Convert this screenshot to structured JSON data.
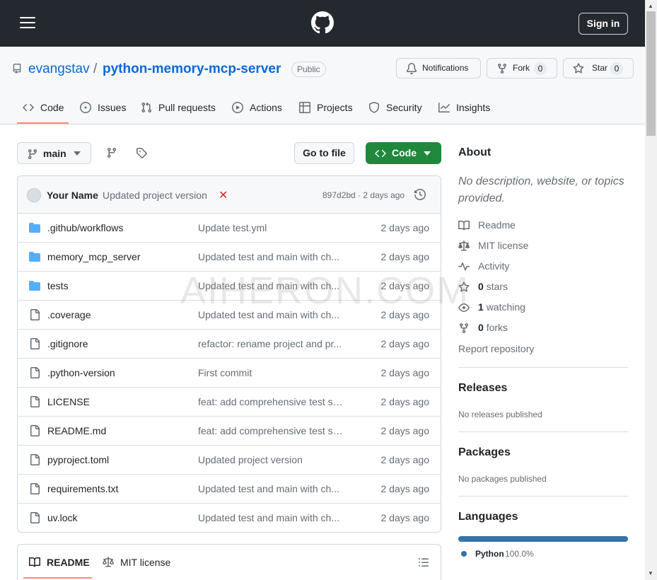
{
  "header": {
    "signin_label": "Sign in"
  },
  "repo": {
    "owner": "evangstav",
    "separator": "/",
    "name": "python-memory-mcp-server",
    "visibility": "Public",
    "notifications_label": "Notifications",
    "fork_label": "Fork",
    "fork_count": "0",
    "star_label": "Star",
    "star_count": "0"
  },
  "tabs": [
    {
      "label": "Code",
      "icon": "code-icon",
      "active": true
    },
    {
      "label": "Issues",
      "icon": "issue-icon"
    },
    {
      "label": "Pull requests",
      "icon": "pull-request-icon"
    },
    {
      "label": "Actions",
      "icon": "play-icon"
    },
    {
      "label": "Projects",
      "icon": "table-icon"
    },
    {
      "label": "Security",
      "icon": "shield-icon"
    },
    {
      "label": "Insights",
      "icon": "graph-icon"
    }
  ],
  "toolbar": {
    "branch": "main",
    "goto_file_label": "Go to file",
    "code_label": "Code"
  },
  "latest_commit": {
    "author": "Your Name",
    "message": "Updated project version",
    "status_mark": "✕",
    "meta": "897d2bd · 2 days ago"
  },
  "files": [
    {
      "name": ".github/workflows",
      "type": "folder",
      "message": "Update test.yml",
      "date": "2 days ago"
    },
    {
      "name": "memory_mcp_server",
      "type": "folder",
      "message": "Updated test and main with ch...",
      "date": "2 days ago"
    },
    {
      "name": "tests",
      "type": "folder",
      "message": "Updated test and main with ch...",
      "date": "2 days ago"
    },
    {
      "name": ".coverage",
      "type": "file",
      "message": "Updated test and main with ch...",
      "date": "2 days ago"
    },
    {
      "name": ".gitignore",
      "type": "file",
      "message": "refactor: rename project and pr...",
      "date": "2 days ago"
    },
    {
      "name": ".python-version",
      "type": "file",
      "message": "First commit",
      "date": "2 days ago"
    },
    {
      "name": "LICENSE",
      "type": "file",
      "message": "feat: add comprehensive test su...",
      "date": "2 days ago"
    },
    {
      "name": "README.md",
      "type": "file",
      "message": "feat: add comprehensive test su...",
      "date": "2 days ago"
    },
    {
      "name": "pyproject.toml",
      "type": "file",
      "message": "Updated project version",
      "date": "2 days ago"
    },
    {
      "name": "requirements.txt",
      "type": "file",
      "message": "Updated test and main with ch...",
      "date": "2 days ago"
    },
    {
      "name": "uv.lock",
      "type": "file",
      "message": "Updated test and main with ch...",
      "date": "2 days ago"
    }
  ],
  "readme_tabs": {
    "readme_label": "README",
    "license_label": "MIT license"
  },
  "about": {
    "heading": "About",
    "description": "No description, website, or topics provided.",
    "readme_label": "Readme",
    "license_label": "MIT license",
    "activity_label": "Activity",
    "stars_count": "0",
    "stars_label": "stars",
    "watching_count": "1",
    "watching_label": "watching",
    "forks_count": "0",
    "forks_label": "forks",
    "report_label": "Report repository"
  },
  "releases": {
    "heading": "Releases",
    "text": "No releases published"
  },
  "packages": {
    "heading": "Packages",
    "text": "No packages published"
  },
  "languages": {
    "heading": "Languages",
    "items": [
      {
        "name": "Python",
        "percent": "100.0%",
        "color": "#3572A5"
      }
    ]
  },
  "watermark": "AIHERON.COM",
  "colors": {
    "accent_green": "#1f883d",
    "link_blue": "#0969da",
    "tab_underline": "#fd8c73",
    "folder_blue": "#54aeff"
  }
}
